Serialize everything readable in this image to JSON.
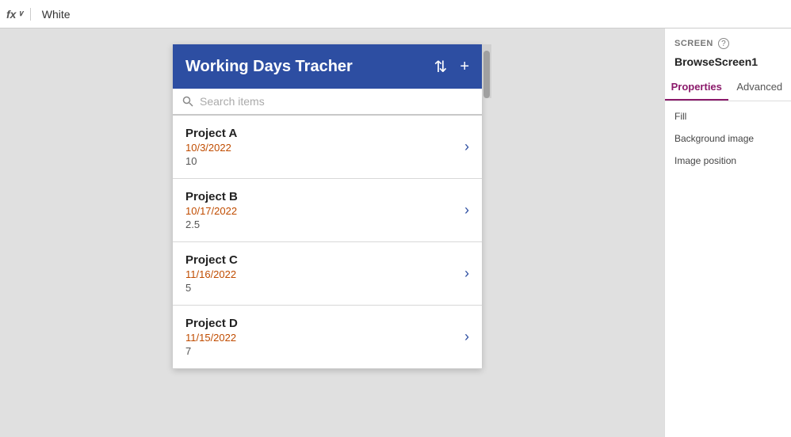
{
  "formulaBar": {
    "fx": "fx",
    "chevron": "∨",
    "value": "White"
  },
  "appPreview": {
    "header": {
      "title": "Working Days Tracher",
      "sortIcon": "⇅",
      "addIcon": "+"
    },
    "search": {
      "placeholder": "Search items"
    },
    "items": [
      {
        "name": "Project A",
        "date": "10/3/2022",
        "count": "10"
      },
      {
        "name": "Project B",
        "date": "10/17/2022",
        "count": "2.5"
      },
      {
        "name": "Project C",
        "date": "11/16/2022",
        "count": "5"
      },
      {
        "name": "Project D",
        "date": "11/15/2022",
        "count": "7"
      }
    ]
  },
  "rightPanel": {
    "screenLabel": "SCREEN",
    "screenName": "BrowseScreen1",
    "tabs": [
      {
        "label": "Properties",
        "active": true
      },
      {
        "label": "Advanced",
        "active": false
      }
    ],
    "properties": [
      {
        "label": "Fill"
      },
      {
        "label": "Background image"
      },
      {
        "label": "Image position"
      }
    ]
  }
}
